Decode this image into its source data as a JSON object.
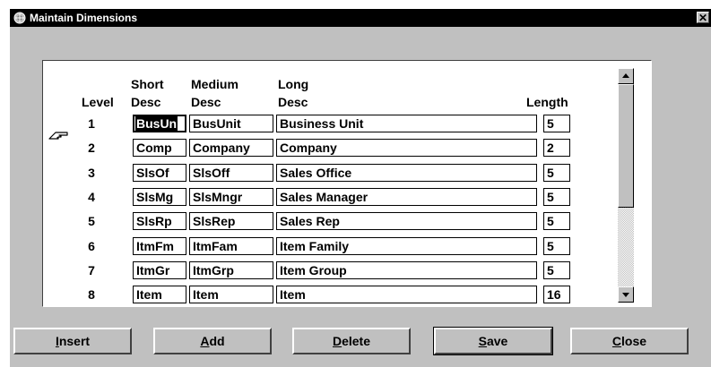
{
  "window": {
    "title": "Maintain Dimensions",
    "close_glyph": "✕"
  },
  "icons": {
    "title": "app-icon",
    "pointer": "hand-pointer-icon",
    "scroll_up": "scroll-up-arrow-icon",
    "scroll_down": "scroll-down-arrow-icon"
  },
  "grid": {
    "headers": {
      "level": "Level",
      "short_line1": "Short",
      "short_line2": "Desc",
      "medium_line1": "Medium",
      "medium_line2": "Desc",
      "long_line1": "Long",
      "long_line2": "Desc",
      "length": "Length"
    },
    "rows": [
      {
        "level": "1",
        "short": "BusUn",
        "medium": "BusUnit",
        "long": "Business Unit",
        "length": "5"
      },
      {
        "level": "2",
        "short": "Comp",
        "medium": "Company",
        "long": "Company",
        "length": "2"
      },
      {
        "level": "3",
        "short": "SlsOf",
        "medium": "SlsOff",
        "long": "Sales Office",
        "length": "5"
      },
      {
        "level": "4",
        "short": "SlsMg",
        "medium": "SlsMngr",
        "long": "Sales Manager",
        "length": "5"
      },
      {
        "level": "5",
        "short": "SlsRp",
        "medium": "SlsRep",
        "long": "Sales Rep",
        "length": "5"
      },
      {
        "level": "6",
        "short": "ItmFm",
        "medium": "ItmFam",
        "long": "Item Family",
        "length": "5"
      },
      {
        "level": "7",
        "short": "ItmGr",
        "medium": "ItmGrp",
        "long": "Item Group",
        "length": "5"
      },
      {
        "level": "8",
        "short": "Item",
        "medium": "Item",
        "long": "Item",
        "length": "16"
      }
    ]
  },
  "buttons": {
    "insert": {
      "mnemonic": "I",
      "rest": "nsert"
    },
    "add": {
      "mnemonic": "A",
      "rest": "dd"
    },
    "delete": {
      "mnemonic": "D",
      "rest": "elete"
    },
    "save": {
      "mnemonic": "S",
      "rest": "ave"
    },
    "close": {
      "mnemonic": "C",
      "rest": "lose"
    }
  }
}
